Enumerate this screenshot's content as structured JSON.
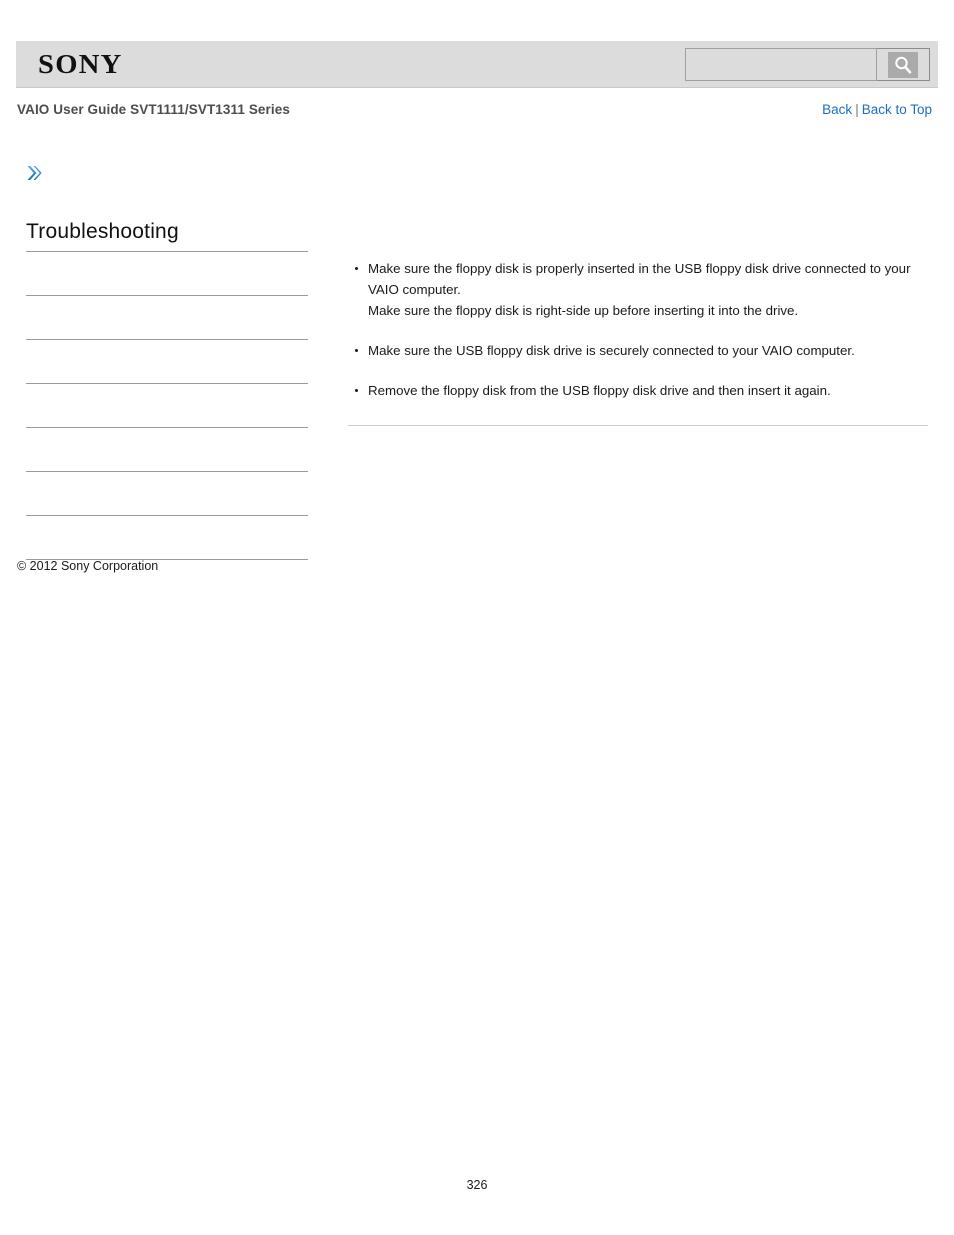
{
  "header": {
    "brand_logo_text": "SONY",
    "search": {
      "value": "",
      "placeholder": "",
      "button_icon": "search-icon"
    },
    "band_color": "#dcdcdc"
  },
  "subheader": {
    "guide_title": "VAIO User Guide SVT1111/SVT1311 Series",
    "links": {
      "back": "Back",
      "separator": "|",
      "back_to_top": "Back to Top"
    },
    "link_color": "#1b6fc4"
  },
  "breadcrumb": {
    "icon": "chevron-double-right-icon",
    "icon_color": "#2e8bd0"
  },
  "sidebar": {
    "title": "Troubleshooting",
    "items": [
      {
        "label": ""
      },
      {
        "label": ""
      },
      {
        "label": ""
      },
      {
        "label": ""
      },
      {
        "label": ""
      },
      {
        "label": ""
      },
      {
        "label": ""
      }
    ]
  },
  "main": {
    "bullets": [
      "Make sure the floppy disk is properly inserted in the USB floppy disk drive connected to your VAIO computer.\nMake sure the floppy disk is right-side up before inserting it into the drive.",
      "Make sure the USB floppy disk drive is securely connected to your VAIO computer.",
      "Remove the floppy disk from the USB floppy disk drive and then insert it again."
    ]
  },
  "footer": {
    "copyright": "© 2012 Sony Corporation",
    "page_number": "326"
  }
}
